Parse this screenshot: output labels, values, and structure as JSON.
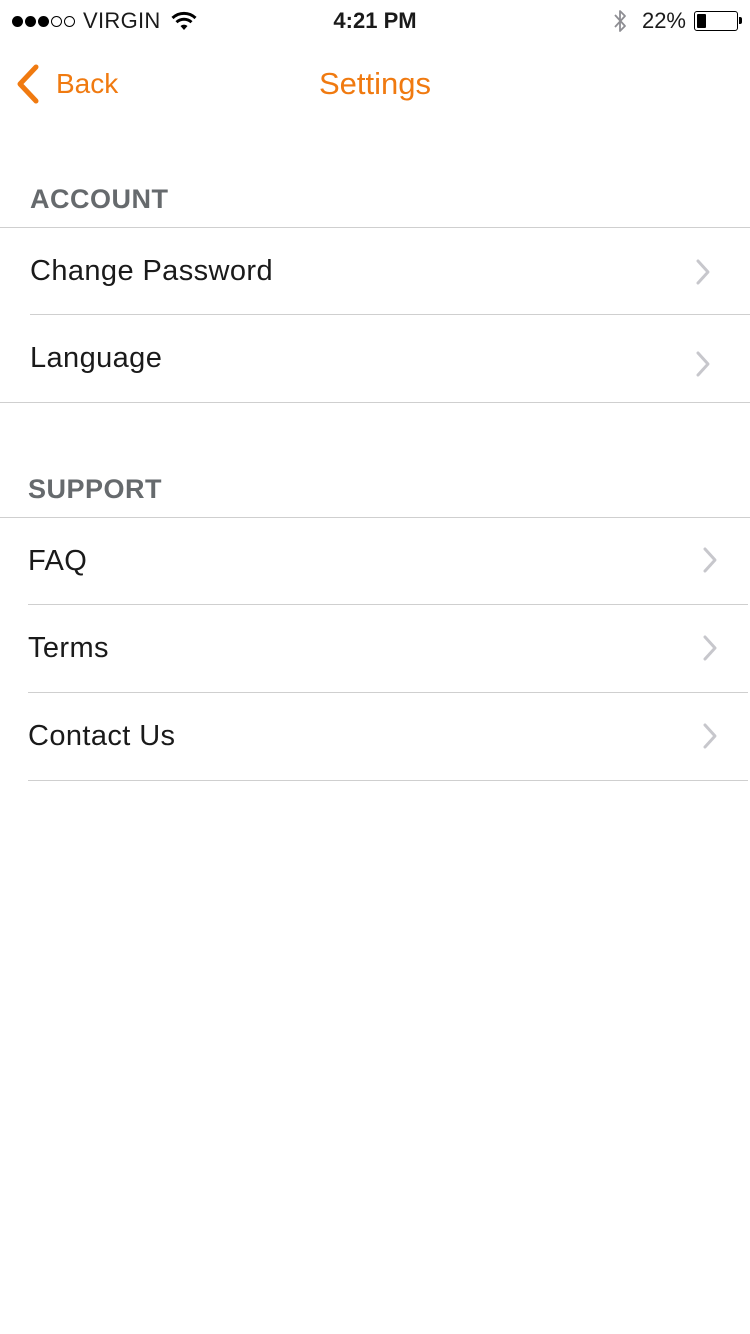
{
  "status_bar": {
    "carrier": "VIRGIN",
    "signal_bars_filled": 3,
    "signal_bars_total": 5,
    "time": "4:21 PM",
    "battery_percent": "22%",
    "battery_level": 0.22,
    "icons": [
      "wifi-icon",
      "bluetooth-icon",
      "battery-icon"
    ]
  },
  "nav": {
    "back_label": "Back",
    "title": "Settings",
    "accent_color": "#f07a10"
  },
  "sections": {
    "account": {
      "header": "ACCOUNT",
      "items": [
        {
          "label": "Change Password"
        },
        {
          "label": "Language"
        }
      ]
    },
    "support": {
      "header": "SUPPORT",
      "items": [
        {
          "label": "FAQ"
        },
        {
          "label": "Terms"
        },
        {
          "label": "Contact Us"
        }
      ]
    }
  },
  "colors": {
    "section_header": "#666a6d",
    "divider": "#cfcfcf",
    "chevron": "#c7c7cc"
  }
}
